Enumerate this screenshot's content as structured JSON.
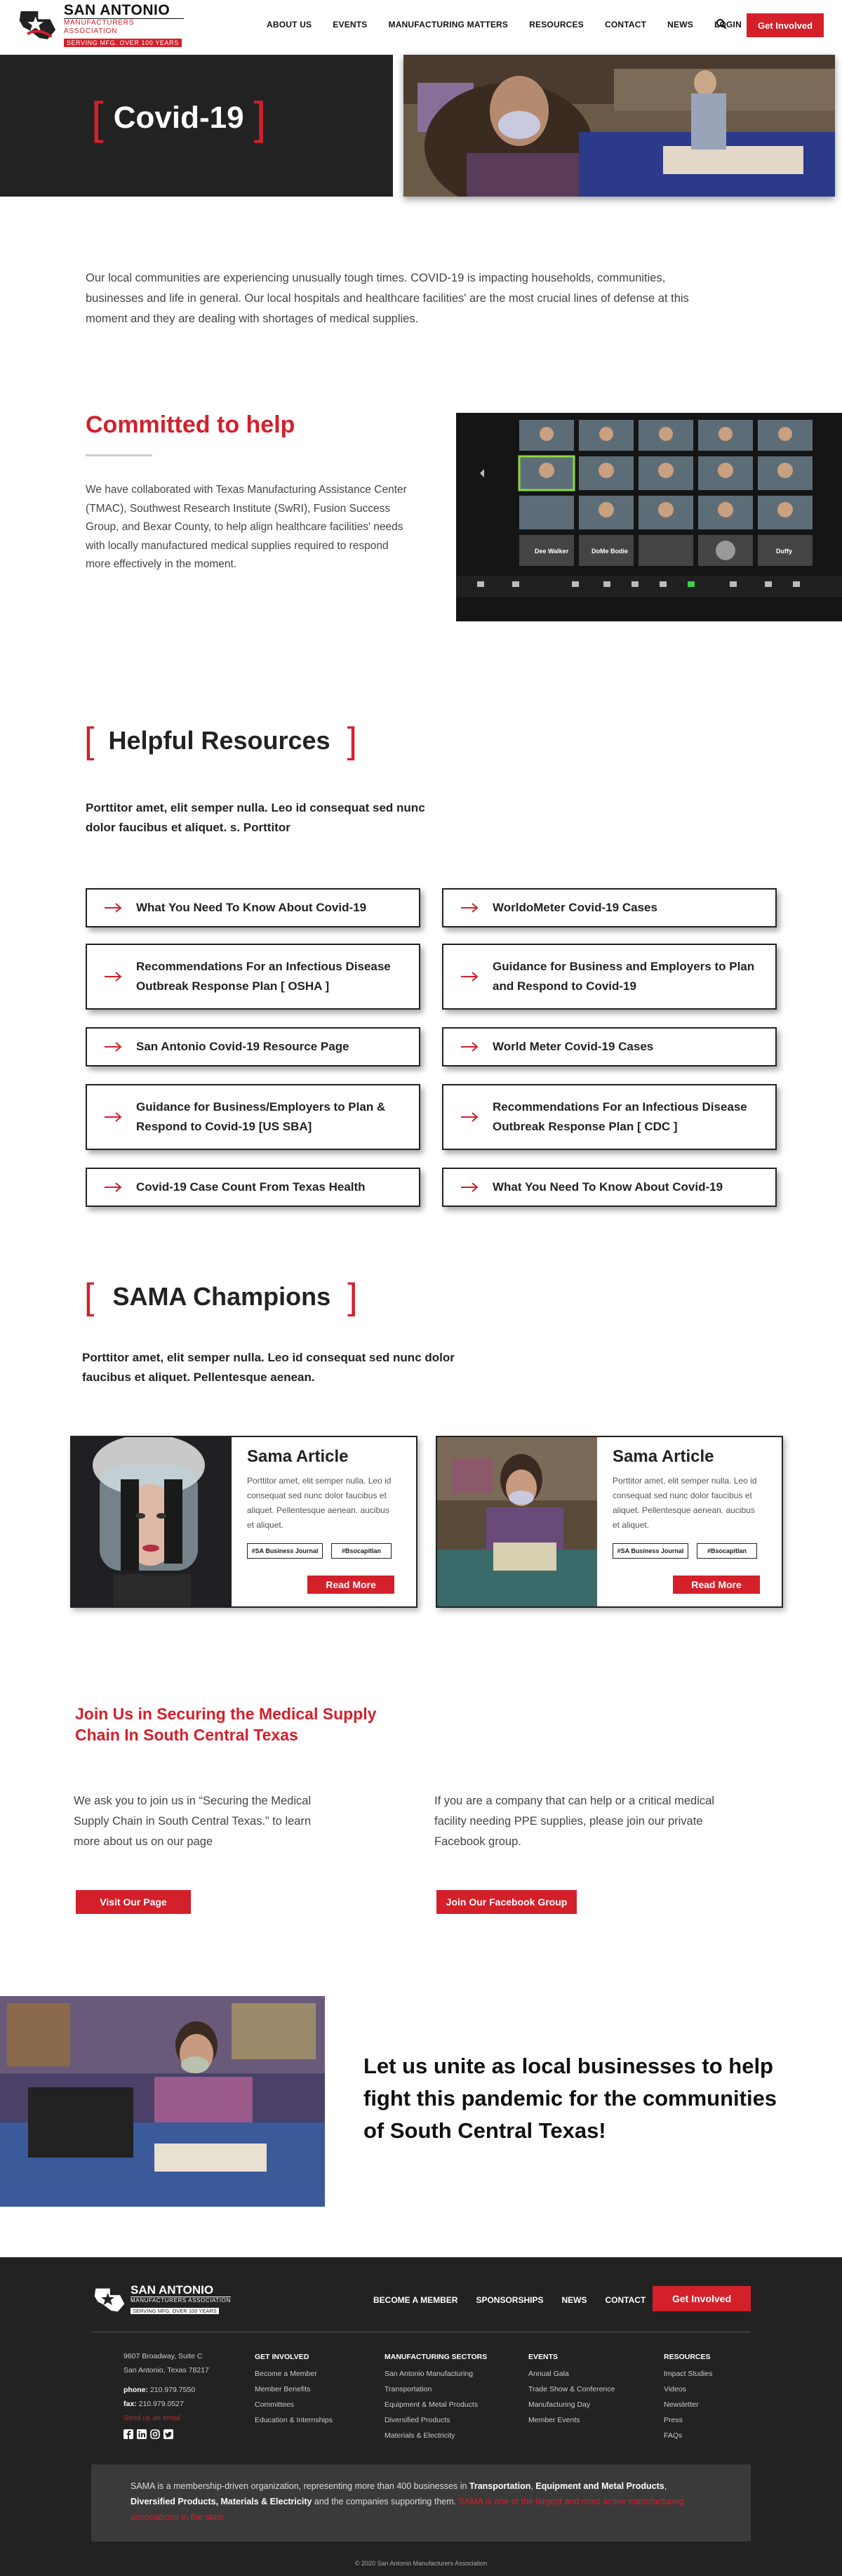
{
  "header": {
    "logo_line1": "SAN ANTONIO",
    "logo_line2": "MANUFACTURERS ASSOCIATION",
    "logo_line3": "SERVING MFG. OVER 100 YEARS",
    "nav": [
      "About Us",
      "Events",
      "Manufacturing Matters",
      "Resources",
      "Contact",
      "News",
      "Login"
    ],
    "cta": "Get Involved"
  },
  "hero": {
    "title": "Covid-19",
    "bracket_open": "[",
    "bracket_close": "]"
  },
  "intro": "Our local communities are experiencing unusually tough times. COVID-19 is impacting households, communities, businesses and life in general. Our local hospitals and healthcare facilities' are the most crucial lines of defense at this moment and they are dealing with shortages of medical supplies.",
  "committed": {
    "title": "Committed to help",
    "body": "We have collaborated with Texas Manufacturing Assistance Center (TMAC), Southwest Research Institute (SwRI), Fusion Success Group, and Bexar County, to help align healthcare facilities' needs with locally manufactured medical supplies required to respond more effectively in the moment.",
    "zoom_names": [
      "Dee Walker",
      "DoMe Bodie",
      "Duffy"
    ]
  },
  "helpful": {
    "title": "Helpful Resources",
    "lead": "Porttitor amet, elit semper nulla. Leo id consequat sed nunc dolor faucibus et aliquet.  s. Porttitor",
    "resources": [
      "What You Need To Know About Covid-19",
      "WorldoMeter Covid-19 Cases",
      "Recommendations For an Infectious Disease Outbreak Response Plan [ OSHA ]",
      "Guidance for Business and Employers to Plan and Respond to Covid-19",
      "San Antonio Covid-19 Resource Page",
      "World Meter Covid-19 Cases",
      "Guidance for Business/Employers to Plan & Respond to Covid-19 [US SBA]",
      "Recommendations For an Infectious Disease Outbreak Response Plan  [ CDC ]",
      "Covid-19 Case Count From Texas Health",
      "What You Need To Know About Covid-19"
    ]
  },
  "champions": {
    "title": "SAMA Champions",
    "lead": "Porttitor amet, elit semper nulla. Leo id consequat sed nunc dolor faucibus et aliquet. Pellentesque aenean.",
    "cards": [
      {
        "title": "Sama Article",
        "body": "Porttitor amet, elit semper nulla. Leo id consequat sed nunc dolor faucibus et aliquet. Pellentesque aenean. aucibus et aliquet.",
        "tag1": "#SA Business Journal",
        "tag2": "#Bsocapitlan",
        "button": "Read More"
      },
      {
        "title": "Sama Article",
        "body": "Porttitor amet, elit semper nulla. Leo id consequat sed nunc dolor faucibus et aliquet. Pellentesque aenean. aucibus et aliquet.",
        "tag1": "#SA Business Journal",
        "tag2": "#Bsocapitlan",
        "button": "Read More"
      }
    ]
  },
  "join": {
    "title": "Join Us in Securing the Medical Supply Chain In South Central Texas",
    "left": "We ask you to join us in “Securing the Medical Supply Chain in South Central Texas.” to learn more about us on our page",
    "right": "If you are a company that can help or a critical medical facility needing PPE supplies, please join our private Facebook group.",
    "btn_left": "Visit Our Page",
    "btn_right": "Join Our Facebook Group"
  },
  "unite": "Let us unite as local businesses to help fight this pandemic for the communities of South Central Texas!",
  "footer": {
    "nav": [
      "Become a Member",
      "Sponsorships",
      "News",
      "Contact"
    ],
    "cta": "Get Involved",
    "address1": "9607 Broadway, Suite C",
    "address2": "San Antonio, Texas 78217",
    "phone_label": "phone:",
    "phone": "210.979.7550",
    "fax_label": "fax:",
    "fax": "210.979.0527",
    "email": "Send us an email",
    "cols": [
      {
        "head": "Get Involved",
        "items": [
          "Become a Member",
          "Member Benefits",
          "Committees",
          "Education & Internships"
        ]
      },
      {
        "head": "Manufacturing Sectors",
        "items": [
          "San Antonio Manufacturing",
          "Transportation",
          "Equipment & Metal Products",
          "Diversified Products",
          "Materials & Electricity"
        ]
      },
      {
        "head": "Events",
        "items": [
          "Annual Gala",
          "Trade Show & Conference",
          "Manufacturing Day",
          "Member Events"
        ]
      },
      {
        "head": "Resources",
        "items": [
          "Impact Studies",
          "Videos",
          "Newsletter",
          "Press",
          "FAQs"
        ]
      }
    ],
    "box_pre": "SAMA is a membership-driven organization, representing more than 400 businesses in ",
    "box_b1": "Transportation",
    "box_sep1": ", ",
    "box_b2": "Equipment and Metal Products",
    "box_sep2": ", ",
    "box_b3": "Diversified Products, Materials & Electricity",
    "box_mid": " and the companies supporting them. ",
    "box_red": "SAMA is one of the largest and most active manufacturing associations in the state.",
    "copyright": "© 2020 San Antonio Manufacturers Association"
  },
  "colors": {
    "accent": "#d4202b",
    "dark": "#222222"
  },
  "icons": [
    "search-icon",
    "arrow-right-icon",
    "facebook-icon",
    "linkedin-icon",
    "instagram-icon",
    "twitter-icon"
  ]
}
